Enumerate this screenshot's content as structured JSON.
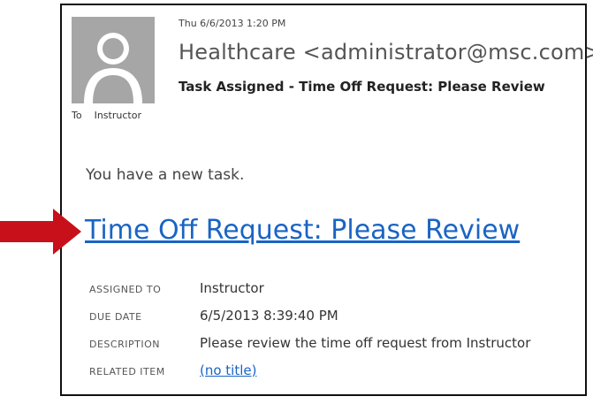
{
  "message": {
    "sent_date": "Thu 6/6/2013 1:20 PM",
    "sender": "Healthcare <administrator@msc.com>",
    "subject": "Task Assigned - Time Off Request: Please Review",
    "to_label": "To",
    "to_name": "Instructor"
  },
  "body": {
    "intro": "You have a new task.",
    "task_link": "Time Off Request: Please Review"
  },
  "details": [
    {
      "key": "ASSIGNED TO",
      "value": "Instructor"
    },
    {
      "key": "DUE DATE",
      "value": "6/5/2013 8:39:40 PM"
    },
    {
      "key": "DESCRIPTION",
      "value": "Please review the time off request from Instructor"
    },
    {
      "key": "RELATED ITEM",
      "value": "(no title)"
    }
  ],
  "icons": {
    "avatar": "person-silhouette-icon",
    "pointer": "red-arrow-icon"
  },
  "colors": {
    "link": "#1a64c4",
    "arrow": "#c8101a",
    "avatar_bg": "#a6a6a6"
  }
}
